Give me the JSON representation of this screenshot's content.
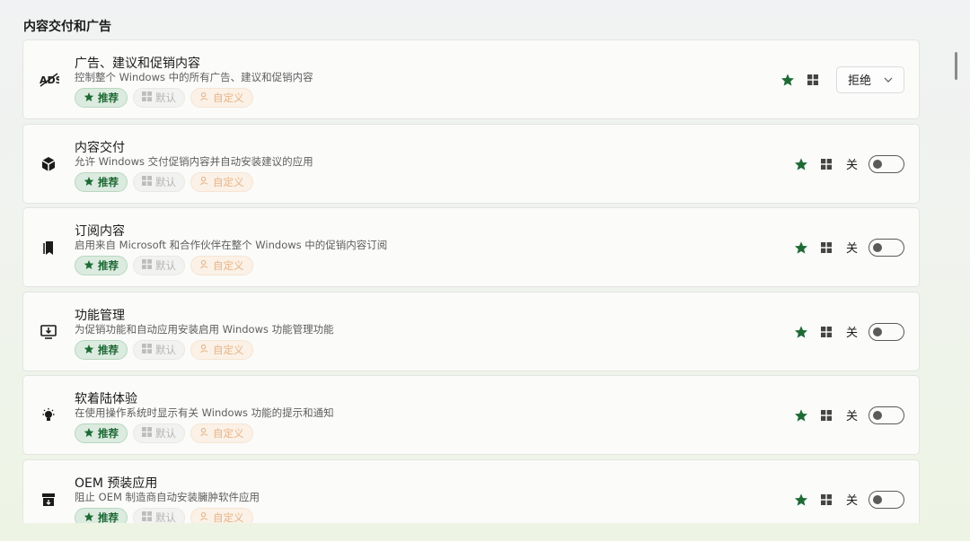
{
  "section": {
    "title": "内容交付和广告"
  },
  "chip_labels": {
    "recommended": "推荐",
    "default": "默认",
    "custom": "自定义"
  },
  "colors": {
    "accent_green": "#1e6a35",
    "chip_green_bg": "#dcebdf",
    "custom_text": "#e6b488"
  },
  "cards": [
    {
      "title": "广告、建议和促销内容",
      "desc": "控制整个 Windows 中的所有广告、建议和促销内容",
      "icon": "ads-icon",
      "control": "dropdown",
      "value": "拒绝"
    },
    {
      "title": "内容交付",
      "desc": "允许 Windows 交付促销内容并自动安装建议的应用",
      "icon": "package-icon",
      "control": "toggle",
      "value": "关"
    },
    {
      "title": "订阅内容",
      "desc": "启用来自 Microsoft 和合作伙伴在整个 Windows 中的促销内容订阅",
      "icon": "bookmarks-icon",
      "control": "toggle",
      "value": "关"
    },
    {
      "title": "功能管理",
      "desc": "为促销功能和自动应用安装启用 Windows 功能管理功能",
      "icon": "monitor-download-icon",
      "control": "toggle",
      "value": "关"
    },
    {
      "title": "软着陆体验",
      "desc": "在使用操作系统时显示有关 Windows 功能的提示和通知",
      "icon": "lightbulb-icon",
      "control": "toggle",
      "value": "关"
    },
    {
      "title": "OEM 预装应用",
      "desc": "阻止 OEM 制造商自动安装臃肿软件应用",
      "icon": "archive-icon",
      "control": "toggle",
      "value": "关"
    }
  ]
}
